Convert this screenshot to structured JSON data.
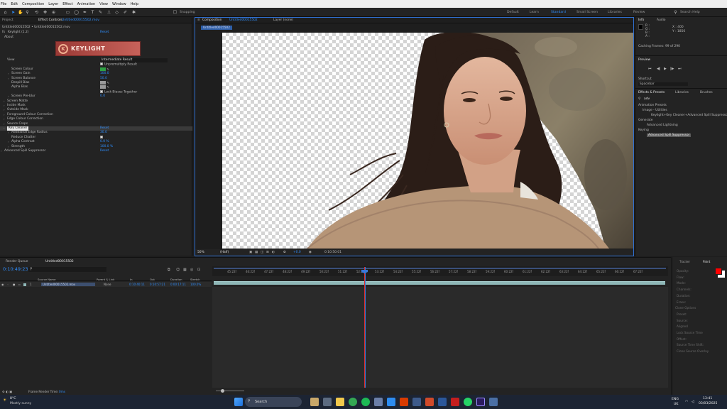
{
  "menu": [
    "File",
    "Edit",
    "Composition",
    "Layer",
    "Effect",
    "Animation",
    "View",
    "Window",
    "Help"
  ],
  "toolbar": {
    "snapping": "Snapping",
    "workspaces": [
      "Default",
      "Learn",
      "Standard",
      "Small Screen",
      "Libraries",
      "Review"
    ],
    "active_workspace": "Standard",
    "search_help": "Search Help"
  },
  "left_panel": {
    "tabs": [
      "Project",
      "Effect Controls",
      "Untitled00015502.mov"
    ],
    "breadcrumb": "Untitled00015502 • Untitled00015502.mov",
    "effect_name": "Keylight (1.2)",
    "reset": "Reset",
    "about": "About",
    "logo_text": "KEYLIGHT",
    "rows": [
      {
        "label": "View",
        "value": "Intermediate Result",
        "indent": 10,
        "tri": false
      },
      {
        "label": "",
        "value": "Unpremultiply Result",
        "indent": 10,
        "tri": false,
        "check": true
      },
      {
        "label": "Screen Colour",
        "value": "",
        "indent": 16,
        "tri": false,
        "swatch": "#2ea043"
      },
      {
        "label": "Screen Gain",
        "value": "100.0",
        "indent": 16,
        "tri": true
      },
      {
        "label": "Screen Balance",
        "value": "50.0",
        "indent": 16,
        "tri": true
      },
      {
        "label": "Despill Bias",
        "value": "",
        "indent": 16,
        "tri": false,
        "swatch": "#9a9a9a"
      },
      {
        "label": "Alpha Bias",
        "value": "",
        "indent": 16,
        "tri": false,
        "swatch": "#9a9a9a"
      },
      {
        "label": "",
        "value": "Lock Biases Together",
        "indent": 16,
        "tri": false,
        "check": true
      },
      {
        "label": "Screen Pre-blur",
        "value": "0.0",
        "indent": 16,
        "tri": true
      },
      {
        "label": "Screen Matte",
        "value": "",
        "indent": 10,
        "tri": true
      },
      {
        "label": "Inside Mask",
        "value": "",
        "indent": 10,
        "tri": true
      },
      {
        "label": "Outside Mask",
        "value": "",
        "indent": 10,
        "tri": true
      },
      {
        "label": "Foreground Colour Correction",
        "value": "",
        "indent": 10,
        "tri": true
      },
      {
        "label": "Edge Colour Correction",
        "value": "",
        "indent": 10,
        "tri": true
      },
      {
        "label": "Source Crops",
        "value": "",
        "indent": 10,
        "tri": true
      },
      {
        "label": "Key Cleaner",
        "value": "Reset",
        "indent": 10,
        "tri": true,
        "sel": true
      },
      {
        "label": "Additional Edge Radius",
        "value": "30.0",
        "indent": 16,
        "tri": true
      },
      {
        "label": "Reduce Chatter",
        "value": "",
        "indent": 16,
        "tri": false,
        "check": true
      },
      {
        "label": "Alpha Contrast",
        "value": "0.0 %",
        "indent": 16,
        "tri": true
      },
      {
        "label": "Strength",
        "value": "100.0 %",
        "indent": 16,
        "tri": true
      },
      {
        "label": "Advanced Spill Suppressor",
        "value": "Reset",
        "indent": 6,
        "tri": true
      }
    ]
  },
  "composition": {
    "tab": "Composition",
    "comp_name": "Untitled00015502",
    "layer_tab": "Layer (none)",
    "subtab": "Untitled00015502",
    "zoom": "50%",
    "resolution": "(Half)",
    "exposure": "+0.0",
    "timecode": "0:10:50:01"
  },
  "info": {
    "tabs": [
      "Info",
      "Audio"
    ],
    "channels": [
      "R :",
      "G :",
      "B :",
      "A :"
    ],
    "x": "X : 400",
    "y": "Y : 1856",
    "caching": "Caching Frames: 99 of 290"
  },
  "preview": {
    "title": "Preview",
    "shortcut_label": "Shortcut",
    "shortcut_value": "Spacebar"
  },
  "effects_presets": {
    "tabs": [
      "Effects & Presets",
      "Libraries",
      "Brushes"
    ],
    "search": "adv",
    "items": [
      {
        "text": "Animation Presets",
        "indent": 4
      },
      {
        "text": "Image - Utilities",
        "indent": 10
      },
      {
        "text": "Keylight+Key Cleaner+Advanced Spill Suppressor",
        "indent": 22
      },
      {
        "text": "Generate",
        "indent": 4
      },
      {
        "text": "Advanced Lightning",
        "indent": 16
      },
      {
        "text": "Keying",
        "indent": 4
      },
      {
        "text": "Advanced Spill Suppressor",
        "indent": 16
      }
    ]
  },
  "timeline": {
    "tabs": [
      "Render Queue",
      "Untitled00015502"
    ],
    "timecode": "0:10:49:23",
    "columns": [
      "Source Name",
      "Parent & Link",
      "In",
      "Out",
      "Duration",
      "Stretch"
    ],
    "layer": {
      "num": "1",
      "name": "Untitled00015502.mov",
      "parent": "None",
      "in": "0:10:40:11",
      "out": "0:10:57:21",
      "duration": "0:00:17:11",
      "stretch": "100.0%"
    },
    "ruler": [
      "45:22f",
      "46:22f",
      "47:22f",
      "48:22f",
      "49:22f",
      "50:22f",
      "51:22f",
      "52:22f",
      "53:22f",
      "54:22f",
      "55:22f",
      "56:22f",
      "57:22f",
      "58:22f",
      "59:22f",
      "60:22f",
      "61:22f",
      "62:22f",
      "63:22f",
      "64:22f",
      "65:22f",
      "66:22f",
      "67:22f"
    ],
    "frame_render_label": "Frame Render Time:",
    "frame_render_value": "0ms"
  },
  "paint": {
    "tabs": [
      "Tracker",
      "Paint"
    ],
    "labels": [
      "Opacity:",
      "Flow:",
      "Mode:",
      "Channels:",
      "Duration:",
      "Erase:",
      "Clone Options",
      "Preset:",
      "Source:",
      "Aligned",
      "Lock Source Time",
      "Offset:",
      "Source Time Shift:",
      "Clone Source Overlay"
    ],
    "fg": "#ff0000",
    "bg": "#ffffff"
  },
  "taskbar": {
    "weather_temp": "8°C",
    "weather_desc": "Mostly sunny",
    "search": "Search",
    "lang": "ENG",
    "region": "UK",
    "time": "13:41",
    "date": "03/03/2025"
  }
}
